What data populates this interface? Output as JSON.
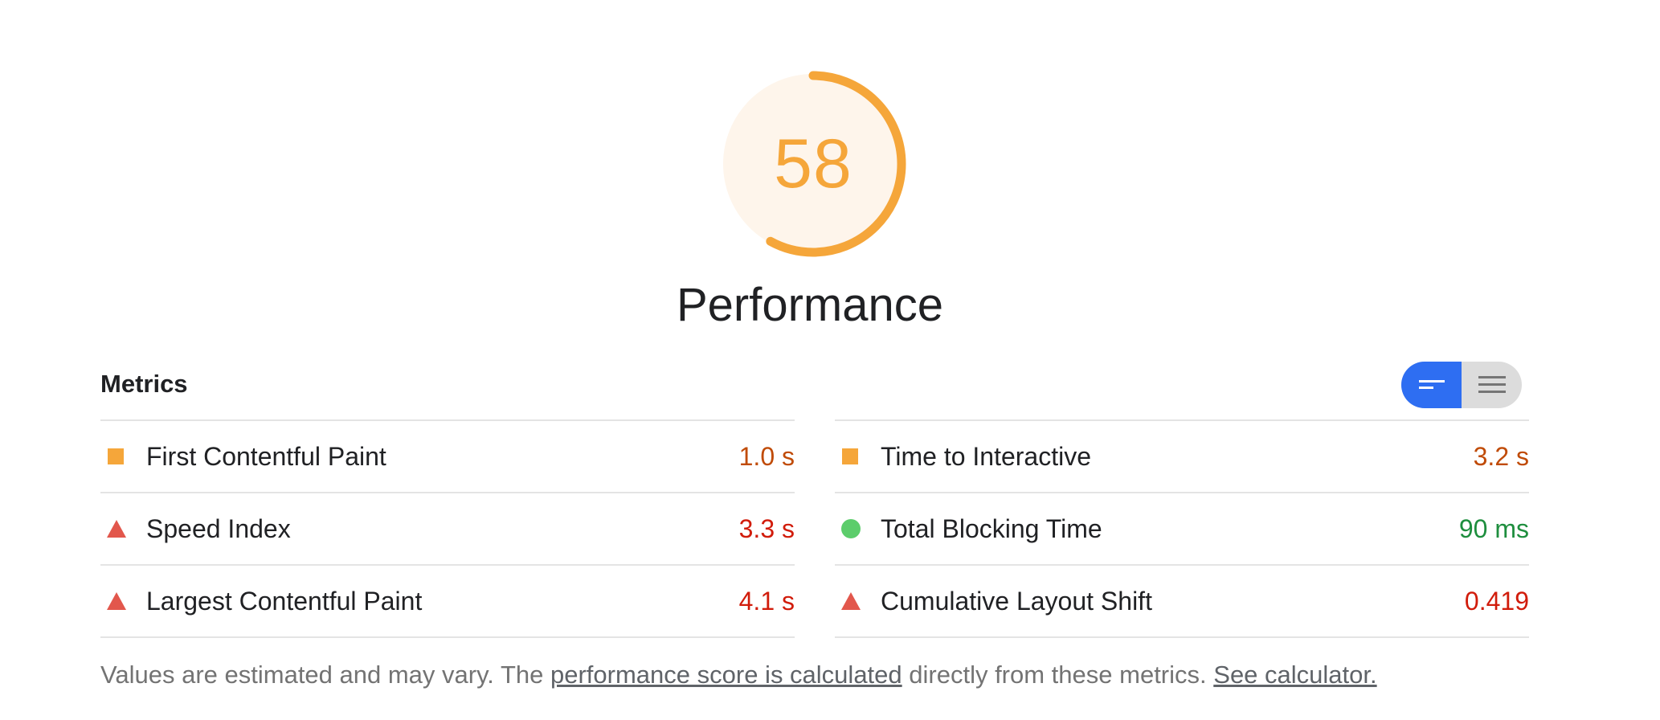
{
  "gauge": {
    "score": "58",
    "score_value": 58,
    "arc_color": "#f5a63a",
    "fill_color": "#fef5eb"
  },
  "category": {
    "title": "Performance"
  },
  "metrics": {
    "header": "Metrics",
    "toggle": {
      "active": "summary-view",
      "options": [
        "summary-view",
        "detailed-view"
      ]
    },
    "left": [
      {
        "label": "First Contentful Paint",
        "value": "1.0 s",
        "status": "average",
        "icon": "orange-square-icon",
        "color": "#c04b07"
      },
      {
        "label": "Speed Index",
        "value": "3.3 s",
        "status": "fail",
        "icon": "red-triangle-icon",
        "color": "#d11c0b"
      },
      {
        "label": "Largest Contentful Paint",
        "value": "4.1 s",
        "status": "fail",
        "icon": "red-triangle-icon",
        "color": "#d11c0b"
      }
    ],
    "right": [
      {
        "label": "Time to Interactive",
        "value": "3.2 s",
        "status": "average",
        "icon": "orange-square-icon",
        "color": "#c04b07"
      },
      {
        "label": "Total Blocking Time",
        "value": "90 ms",
        "status": "pass",
        "icon": "green-circle-icon",
        "color": "#1e8e3e"
      },
      {
        "label": "Cumulative Layout Shift",
        "value": "0.419",
        "status": "fail",
        "icon": "red-triangle-icon",
        "color": "#d11c0b"
      }
    ]
  },
  "footnote": {
    "prefix": "Values are estimated and may vary. The ",
    "link1": "performance score is calculated",
    "middle": " directly from these metrics.",
    "link2": "See calculator."
  },
  "colors": {
    "average": "#f5a63a",
    "fail": "#e2574c",
    "pass": "#5ccd6b",
    "toggle_active": "#2e6ef2"
  }
}
